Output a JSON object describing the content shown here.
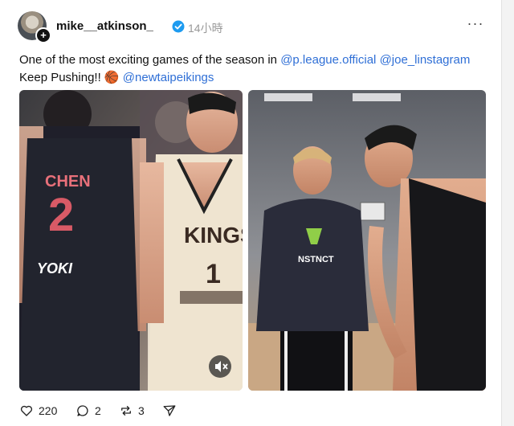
{
  "post": {
    "username": "mike__atkinson_",
    "time": "14小時",
    "text_line1": "One of the most exciting games of the season in ",
    "mention1": "@p.league.official",
    "mention2": "@joe_linstagram",
    "text_line2": "Keep Pushing!! ",
    "mention3": "@newtaipeikings"
  },
  "media": {
    "left": {
      "jersey_name": "CHEN",
      "jersey_number": "2",
      "sponsor": "YOKI",
      "right_player_team": "KINGS",
      "right_player_number": "1"
    },
    "right": {
      "shirt_logo": "NSTNCT"
    }
  },
  "actions": {
    "likes": "220",
    "comments": "2",
    "reposts": "3"
  },
  "colors": {
    "link": "#2f6fd6",
    "verified": "#1d9bf0"
  },
  "icons": [
    "plus-icon",
    "verified-badge-icon",
    "more-icon",
    "mute-icon",
    "heart-icon",
    "comment-icon",
    "repost-icon",
    "share-icon"
  ]
}
